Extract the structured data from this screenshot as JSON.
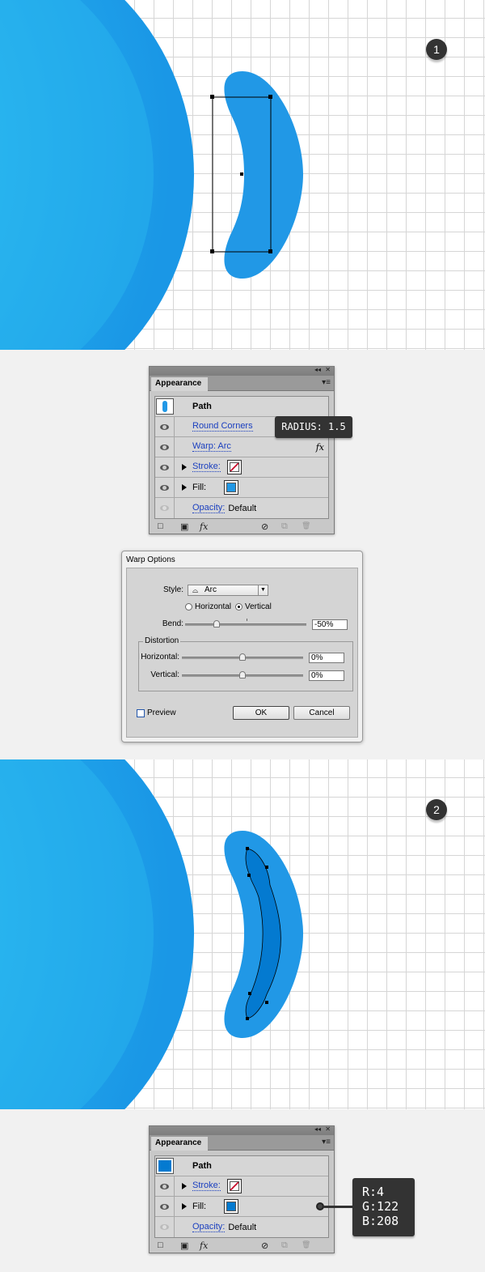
{
  "steps": [
    {
      "number": "1"
    },
    {
      "number": "2"
    }
  ],
  "colors": {
    "shape_light": "#2198e6",
    "shape_dark": "#047ad0",
    "circle": "#26aeee"
  },
  "panel1": {
    "collapse_icon": "◂◂",
    "close_icon": "✕",
    "tab": "Appearance",
    "menu_icon": "▾≡",
    "path_label": "Path",
    "rows": {
      "round_corners": "Round Corners",
      "warp": "Warp: Arc",
      "fx": "fx",
      "stroke": "Stroke:",
      "fill": "Fill:",
      "opacity": "Opacity:",
      "opacity_value": "Default"
    },
    "fill_color": "#2198e6",
    "footer": {
      "new_stroke": "□",
      "new_fill": "▣",
      "fx": "fx",
      "clear": "⊘",
      "duplicate": "⧉",
      "delete": "🗑"
    }
  },
  "tooltip1": {
    "text": "RADIUS: 1.5"
  },
  "warp_dialog": {
    "title": "Warp Options",
    "style_label": "Style:",
    "style_value": "Arc",
    "horizontal_label": "Horizontal",
    "vertical_label": "Vertical",
    "orientation_selected": "Vertical",
    "bend_label": "Bend:",
    "bend_value": "-50%",
    "bend_fraction": -0.5,
    "distortion_label": "Distortion",
    "dist_horizontal_label": "Horizontal:",
    "dist_horizontal_value": "0%",
    "dist_vertical_label": "Vertical:",
    "dist_vertical_value": "0%",
    "preview_label": "Preview",
    "preview_checked": false,
    "ok": "OK",
    "cancel": "Cancel"
  },
  "panel2": {
    "collapse_icon": "◂◂",
    "close_icon": "✕",
    "tab": "Appearance",
    "menu_icon": "▾≡",
    "path_label": "Path",
    "rows": {
      "stroke": "Stroke:",
      "fill": "Fill:",
      "opacity": "Opacity:",
      "opacity_value": "Default"
    },
    "fill_color": "#047ad0",
    "footer": {
      "new_stroke": "□",
      "new_fill": "▣",
      "fx": "fx",
      "clear": "⊘",
      "duplicate": "⧉",
      "delete": "🗑"
    }
  },
  "tooltip2": {
    "r": "R:4",
    "g": "G:122",
    "b": "B:208"
  }
}
